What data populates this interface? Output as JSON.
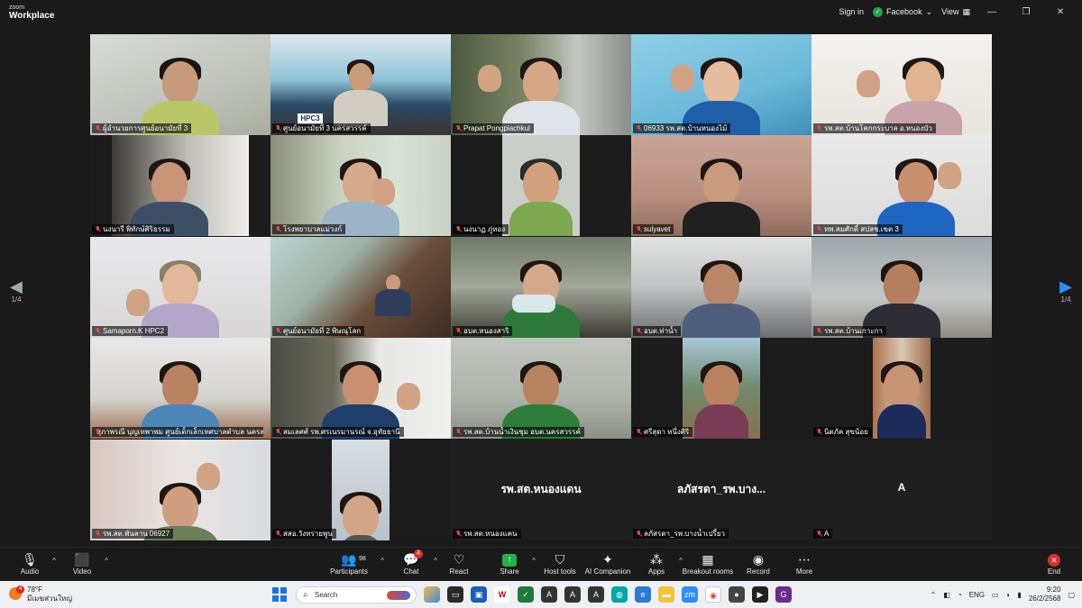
{
  "titlebar": {
    "brand_small": "zoom",
    "brand_big": "Workplace",
    "sign_in": "Sign in",
    "facebook_label": "Facebook",
    "view_label": "View"
  },
  "pager": {
    "left_label": "1/4",
    "right_label": "1/4"
  },
  "tiles": [
    {
      "label": "ผู้อำนวยการศูนย์อนามัยที่ 3"
    },
    {
      "label": "ศูนย์อนามัยที่ 3 นครสวรรค์",
      "banner": "HPC3"
    },
    {
      "label": "Prapat Pongpiachkul"
    },
    {
      "label": "06933 รพ.สต.บ้านหนองไม้"
    },
    {
      "label": "รพ.สต.บ้านโคกกระบาล อ.หนองบัว"
    },
    {
      "label": "นงนารี พิทักษ์ศิริธรรม"
    },
    {
      "label": "โรงพยาบาลแม่วงก์"
    },
    {
      "label": "นงนาฏ ภู่ทอง"
    },
    {
      "label": "sulyavet"
    },
    {
      "label": "ทพ.สมศักดิ์ สปสช.เขต 3"
    },
    {
      "label": "Samaporn.K HPC2"
    },
    {
      "label": "ศูนย์อนามัยที่ 2 พิษณุโลก"
    },
    {
      "label": "อบต.หนองสาริ"
    },
    {
      "label": "อบต.ท่าน้ำ"
    },
    {
      "label": "รพ.สต.บ้านเกาะกา"
    },
    {
      "label": "สุภาพรณี บุญเทพาพม ศูนย์เด็กเล็กเทศบาลตำบล นครสวรรค์"
    },
    {
      "label": "สมเลศศ์ รพ.ศรเนรมานรณ์ จ.อุทัยธานี"
    },
    {
      "label": "รพ.สต.บ้านน้ำเงินชุม อบต.นครสวรรค์"
    },
    {
      "label": "ศรีสุดา หนึ่งศิริ"
    },
    {
      "label": "นิตภัค สุขน้อย"
    },
    {
      "label": "รพ.สต.พันลาน 06927"
    },
    {
      "label": "สสอ.วังทรายพูน"
    },
    {
      "label": "รพ.สต.หนองแคน",
      "big_name": "รพ.สต.หนองแดน"
    },
    {
      "label": "ลภัสรดา_รพ.บางน้ำเปรี้ยว",
      "big_name": "ลภัสรดา_รพ.บาง..."
    },
    {
      "label": "A",
      "big_name": "A"
    }
  ],
  "toolbar": {
    "audio": "Audio",
    "video": "Video",
    "participants": "Participants",
    "participants_count": "98",
    "chat": "Chat",
    "chat_badge": "4",
    "react": "React",
    "share": "Share",
    "host_tools": "Host tools",
    "ai_companion": "AI Companion",
    "apps": "Apps",
    "breakout_rooms": "Breakout rooms",
    "record": "Record",
    "more": "More",
    "end": "End"
  },
  "taskbar": {
    "weather_temp": "78°F",
    "weather_desc": "มีเมฆส่วนใหญ่",
    "weather_badge": "4",
    "search_placeholder": "Search",
    "language": "ENG",
    "time": "9:20",
    "date": "26/2/2568"
  },
  "colors": {
    "active_speaker": "#2dd462",
    "muted_mic": "#e04848",
    "accent_blue": "#2d8cff",
    "end_red": "#e02b2b"
  }
}
